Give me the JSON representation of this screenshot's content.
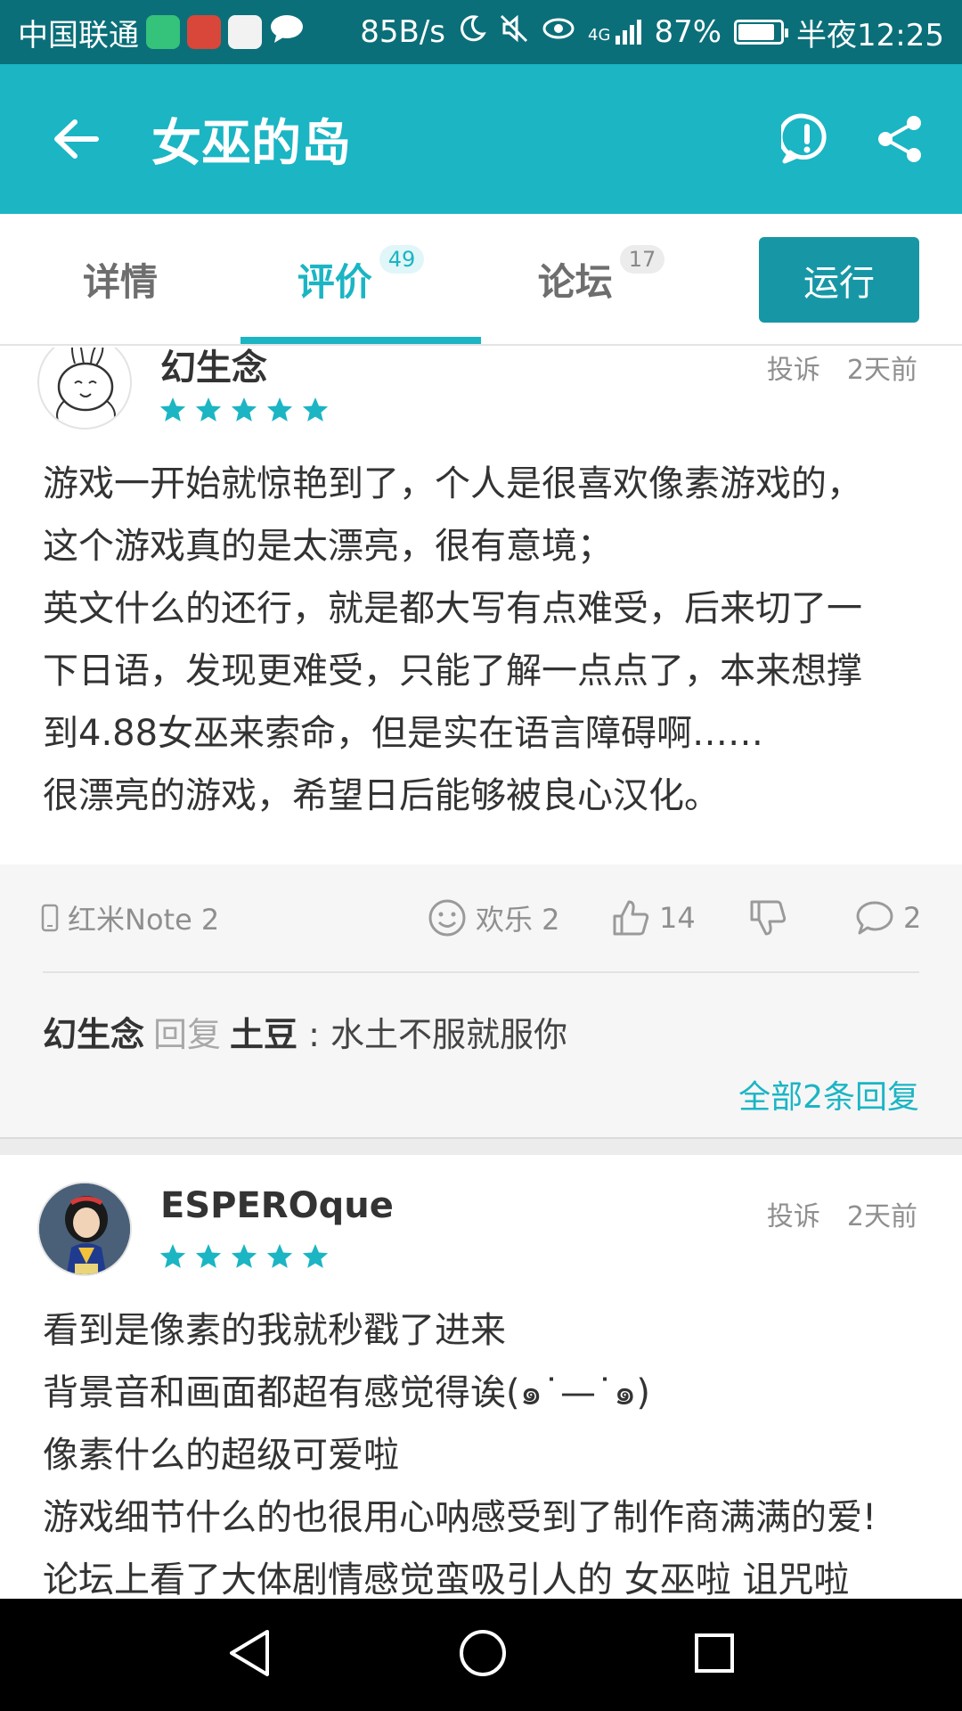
{
  "status_bar": {
    "carrier": "中国联通",
    "network_speed": "85B/s",
    "signal_label": "4G",
    "battery": "87%",
    "battery_level": 0.87,
    "time": "半夜12:25",
    "apps": [
      {
        "name": "taptap-app-icon",
        "color": "#35c27a"
      },
      {
        "name": "huawei-app-icon",
        "color": "#d9463a"
      },
      {
        "name": "weibo-app-icon",
        "color": "#f2f2f2"
      },
      {
        "name": "message-app-icon",
        "color": "#ffffff"
      }
    ]
  },
  "app_bar": {
    "title": "女巫的岛",
    "icons": [
      "back-arrow-icon",
      "report-icon",
      "share-icon"
    ]
  },
  "tabs": {
    "items": [
      {
        "label": "详情",
        "badge": ""
      },
      {
        "label": "评价",
        "badge": "49",
        "active": true
      },
      {
        "label": "论坛",
        "badge": "17"
      }
    ],
    "run_button": "运行"
  },
  "colors": {
    "primary": "#1bb5c4",
    "status_bar": "#0b6f79",
    "run_button": "#1797a6",
    "star": "#1bb5c4"
  },
  "reviews": [
    {
      "username": "幻生念",
      "rating": 5,
      "report": "投诉",
      "time": "2天前",
      "text": "游戏一开始就惊艳到了，个人是很喜欢像素游戏的，\n这个游戏真的是太漂亮，很有意境；\n英文什么的还行，就是都大写有点难受，后来切了一\n下日语，发现更难受，只能了解一点点了，本来想撑\n到4.88女巫来索命，但是实在语言障碍啊……\n很漂亮的游戏，希望日后能够被良心汉化。",
      "device": "红米Note 2",
      "reaction": "欢乐 2",
      "likes": "14",
      "comments": "2",
      "reply": {
        "from": "幻生念",
        "verb": "回复",
        "to": "土豆",
        "sep": ":",
        "text": "水土不服就服你"
      },
      "all_replies": "全部2条回复"
    },
    {
      "username": "ESPEROque",
      "rating": 5,
      "report": "投诉",
      "time": "2天前",
      "text": "看到是像素的我就秒戳了进来\n背景音和画面都超有感觉得诶(๑˙—˙๑)\n像素什么的超级可爱啦\n游戏细节什么的也很用心呐感受到了制作商满满的爱!\n论坛上看了大体剧情感觉蛮吸引人的 女巫啦 诅咒啦"
    }
  ]
}
